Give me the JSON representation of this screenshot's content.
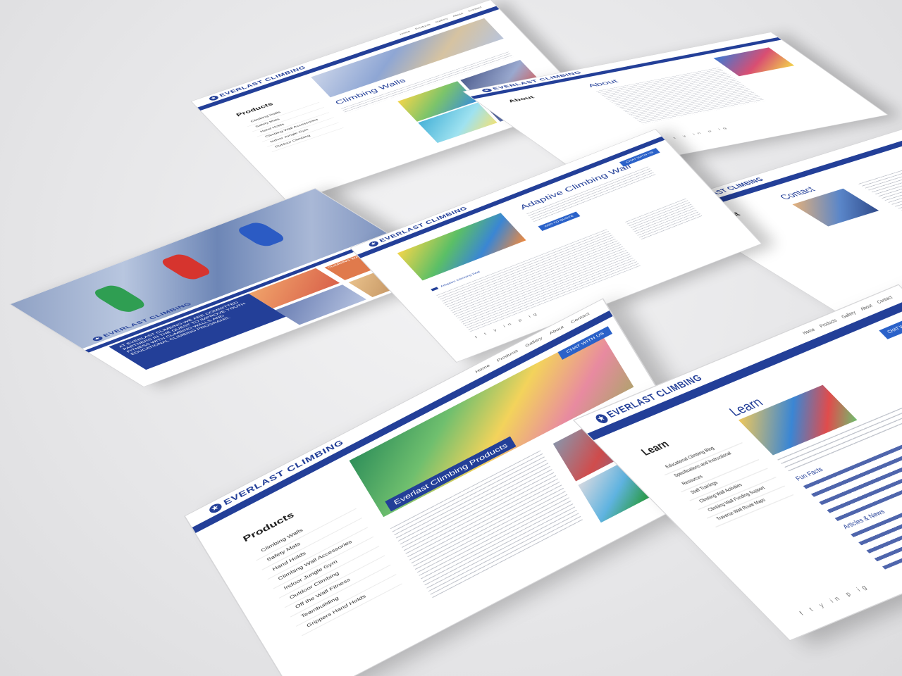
{
  "brand": {
    "logo_text": "EVERLAST CLIMBING",
    "accent": "#233f98",
    "button_blue": "#2b62c9"
  },
  "nav": [
    "Home",
    "Products",
    "Gallery",
    "About",
    "Contact"
  ],
  "home": {
    "hero_banner": "AT EVERLAST CLIMBING WE ARE COMMITTED PARTNERS IN THE QUEST TO IMPROVE YOUTH FITNESS WITH CLIMBING WALLS AND EDUCATIONAL CLIMBING PROGRAMS.",
    "tile_label": "CLIMBING WALLS"
  },
  "products": {
    "side_title": "Products",
    "items": [
      "Climbing Walls",
      "Safety Mats",
      "Hand Holds",
      "Climbing Wall Accessories",
      "Indoor Jungle Gym",
      "Outdoor Climbing",
      "Off the Wall Fitness",
      "Teambuilding",
      "Grippers Hand Holds"
    ],
    "overlay_title": "Everlast Climbing Products",
    "chat_button": "CHAT WITH US"
  },
  "climbing_walls": {
    "side_title": "Products",
    "main_title": "Climbing Walls"
  },
  "product_detail": {
    "main_title": "Adaptive Climbing Wall",
    "add_button": "ADD TO QUOTE",
    "section_link": "Adaptive Climbing Wall"
  },
  "about": {
    "side_title": "About",
    "main_title": "About"
  },
  "contact": {
    "side_title": "About",
    "main_title": "Contact"
  },
  "learn": {
    "side_title": "Learn",
    "main_title": "Learn",
    "items": [
      "Educational Climbing Blog",
      "Specifications and Instructional Resources",
      "Staff Trainings",
      "Climbing Wall Activities",
      "Climbing Wall Funding Support",
      "Traverse Wall Route Maps"
    ],
    "sub_heading_1": "Fun Facts",
    "sub_heading_2": "Articles & News"
  },
  "footer": {
    "social_icons": "f t y in p ig"
  }
}
